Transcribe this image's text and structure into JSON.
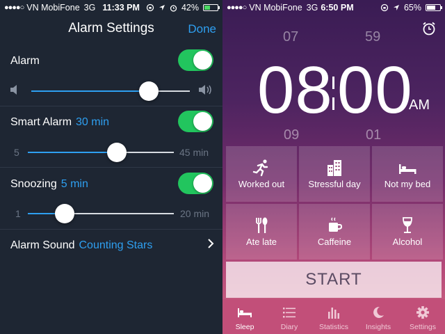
{
  "left_screen": {
    "status": {
      "signal": "●●●●○",
      "carrier": "VN MobiFone",
      "network": "3G",
      "time": "11:33 PM",
      "battery_text": "42%",
      "battery_level": 0.42
    },
    "title": "Alarm Settings",
    "done_label": "Done",
    "alarm": {
      "label": "Alarm",
      "enabled": true,
      "volume_level": 0.74
    },
    "smart_alarm": {
      "label": "Smart Alarm",
      "value": "30 min",
      "enabled": true,
      "min_label": "5",
      "max_label": "45 min",
      "level": 0.61
    },
    "snoozing": {
      "label": "Snoozing",
      "value": "5 min",
      "enabled": true,
      "min_label": "1",
      "max_label": "20 min",
      "level": 0.25
    },
    "alarm_sound": {
      "label": "Alarm Sound",
      "value": "Counting Stars"
    },
    "colors": {
      "accent": "#2e9ff0",
      "toggle_on": "#22c55e",
      "background": "#1e2633"
    }
  },
  "right_screen": {
    "status": {
      "signal": "●●●●○",
      "carrier": "VN MobiFone",
      "network": "3G",
      "time": "6:50 PM",
      "battery_text": "65%",
      "battery_level": 0.65
    },
    "wheel": {
      "hour_prev": "07",
      "minute_prev": "59",
      "hour_next": "09",
      "minute_next": "01"
    },
    "alarm_time": {
      "hour": "08",
      "minute": "00",
      "ampm": "AM"
    },
    "tiles": [
      {
        "label": "Worked out",
        "icon": "running-icon"
      },
      {
        "label": "Stressful day",
        "icon": "buildings-icon"
      },
      {
        "label": "Not my bed",
        "icon": "bed-icon"
      },
      {
        "label": "Ate late",
        "icon": "fork-knife-icon"
      },
      {
        "label": "Caffeine",
        "icon": "coffee-cup-icon"
      },
      {
        "label": "Alcohol",
        "icon": "wine-glass-icon"
      }
    ],
    "start_label": "START",
    "tabs": [
      {
        "label": "Sleep",
        "icon": "bed-icon",
        "active": true
      },
      {
        "label": "Diary",
        "icon": "list-icon",
        "active": false
      },
      {
        "label": "Statistics",
        "icon": "bar-chart-icon",
        "active": false
      },
      {
        "label": "Insights",
        "icon": "moon-icon",
        "active": false
      },
      {
        "label": "Settings",
        "icon": "gear-icon",
        "active": false
      }
    ],
    "colors": {
      "gradient_top": "#3a1c54",
      "gradient_bottom": "#d06882",
      "tabbar": "#c24f79"
    }
  }
}
